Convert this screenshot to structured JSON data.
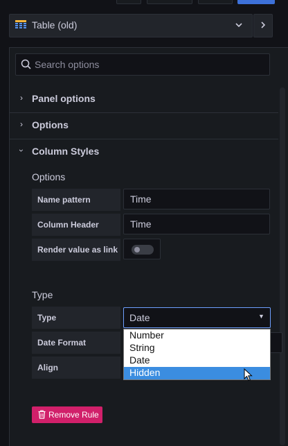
{
  "visualization": {
    "name": "Table (old)",
    "icon": "table-icon",
    "chevron_icon": "chevron-down-icon",
    "next_icon": "chevron-right-icon"
  },
  "search": {
    "placeholder": "Search options",
    "icon": "search-icon"
  },
  "sections": {
    "panel_options": "Panel options",
    "options": "Options",
    "column_styles": "Column Styles"
  },
  "column_styles": {
    "options_label": "Options",
    "name_pattern_label": "Name pattern",
    "name_pattern_value": "Time",
    "column_header_label": "Column Header",
    "column_header_value": "Time",
    "render_link_label": "Render value as link",
    "render_link_on": false,
    "type_section_label": "Type",
    "type_label": "Type",
    "type_value": "Date",
    "type_options": [
      "Number",
      "String",
      "Date",
      "Hidden"
    ],
    "type_highlighted": "Hidden",
    "date_format_label": "Date Format",
    "align_label": "Align",
    "remove_rule_label": "Remove Rule",
    "remove_icon": "trash-icon"
  },
  "colors": {
    "background": "#111217",
    "panel": "#181b1f",
    "accent_danger": "#d1206a",
    "focus_border": "#6e9fff",
    "option_highlight": "#3b8de0"
  }
}
